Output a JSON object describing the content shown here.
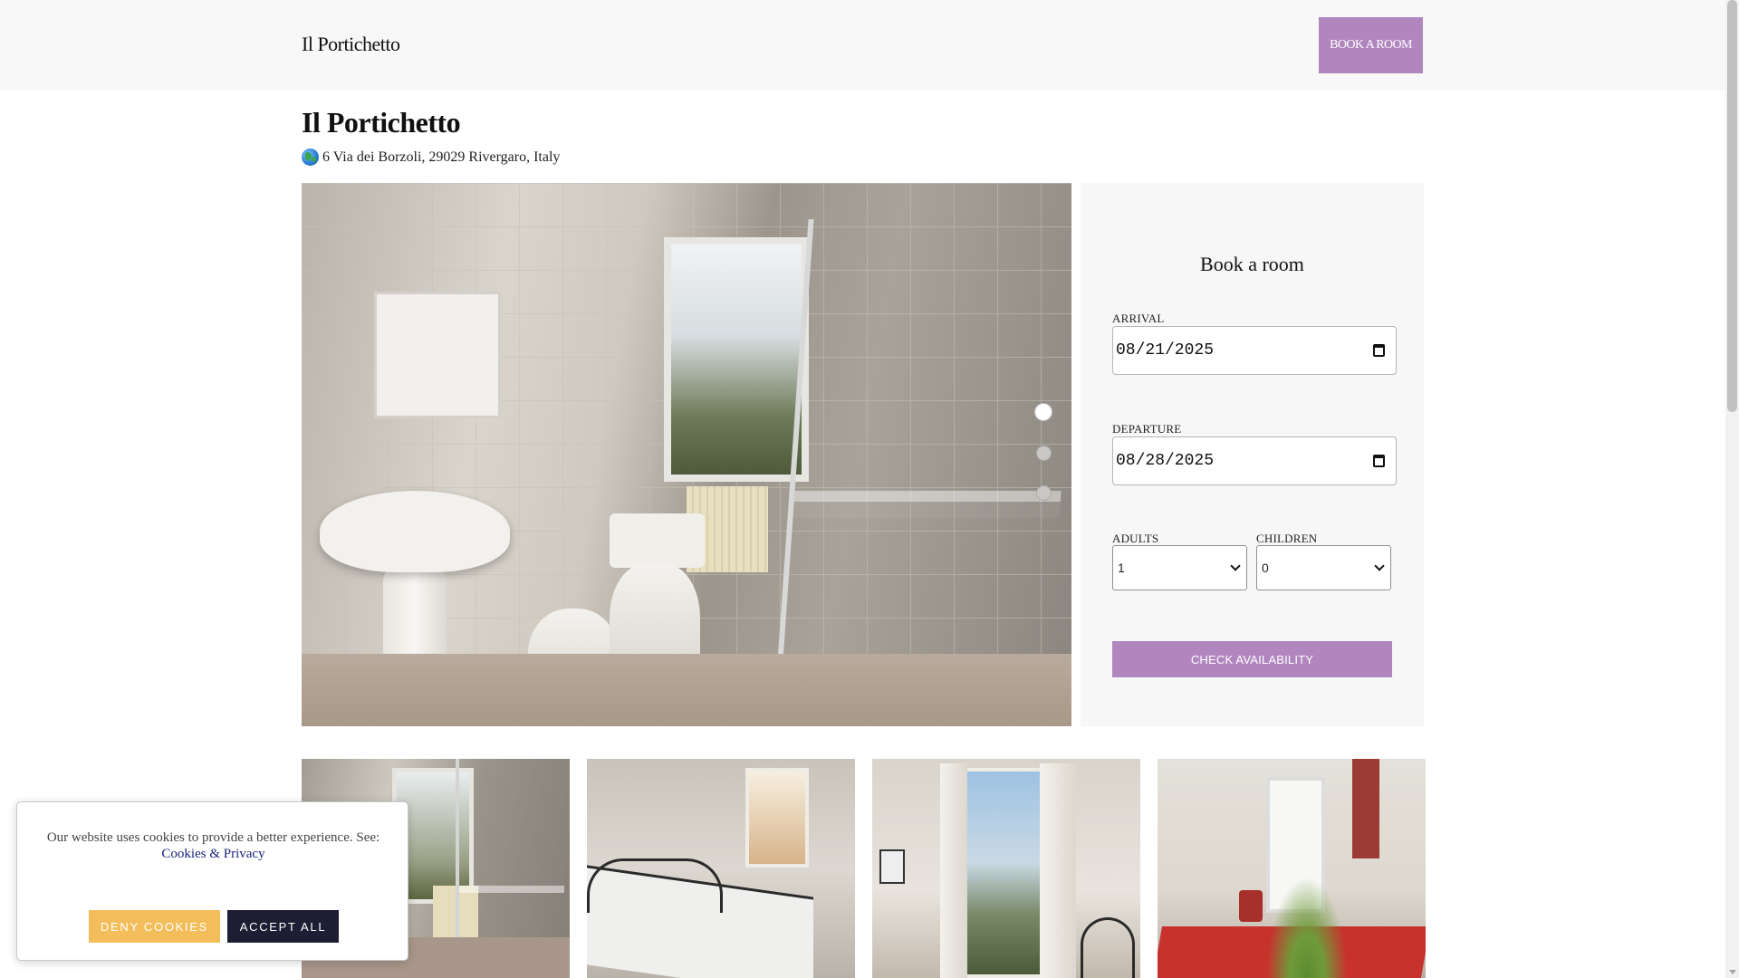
{
  "header": {
    "brand": "Il Portichetto",
    "book_button": "BOOK A ROOM"
  },
  "hotel": {
    "name": "Il Portichetto",
    "address_icon": "globe-icon",
    "address": "6 Via dei Borzoli, 29029 Rivergaro, Italy"
  },
  "gallery": {
    "active_slide": 1,
    "slide_count": 3,
    "thumbnails": [
      "bathroom photo",
      "twin bedroom photo",
      "balcony bedroom photo",
      "terrace photo"
    ]
  },
  "booking": {
    "title": "Book a room",
    "arrival_label": "ARRIVAL",
    "arrival_value": "08/21/2025",
    "departure_label": "DEPARTURE",
    "departure_value": "08/28/2025",
    "adults_label": "ADULTS",
    "adults_value": "1",
    "children_label": "CHILDREN",
    "children_value": "0",
    "check_button": "CHECK AVAILABILITY"
  },
  "cookie": {
    "text": "Our website uses cookies to provide a better experience. See:",
    "link": "Cookies & Privacy",
    "deny": "DENY COOKIES",
    "accept": "ACCEPT ALL"
  },
  "colors": {
    "accent": "#b186bf",
    "deny": "#f4bd5b",
    "accept": "#1d1d33"
  }
}
